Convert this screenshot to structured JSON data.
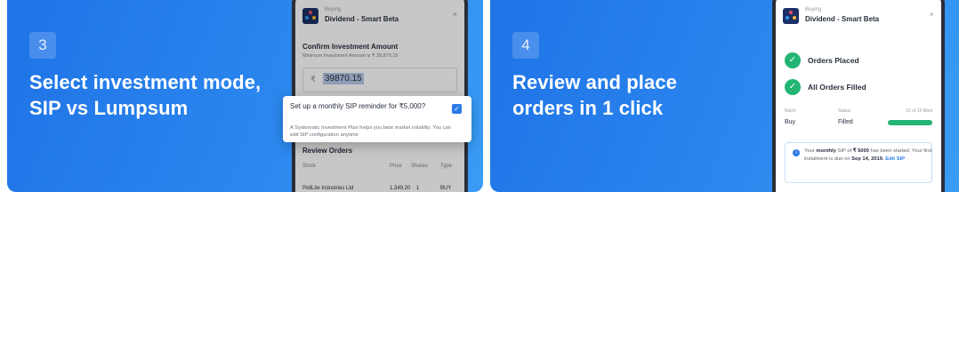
{
  "steps": [
    {
      "number": "3",
      "headline": [
        "Select investment mode,",
        "SIP vs Lumpsum"
      ],
      "mockup": {
        "buying_label": "Buying",
        "fund_name": "Dividend - Smart Beta",
        "close": "×",
        "confirm_title": "Confirm Investment Amount",
        "min_amount_text": "Minimum Investment Amount is ₹ 39,870.15",
        "currency": "₹",
        "amount": "39870.15",
        "popup": {
          "title": "Set up a monthly SIP reminder for ₹5,000?",
          "description": "A Systematic Investment Plan helps you beat market volatility. You can edit SIP configuration anytime",
          "checked": true
        },
        "review_title": "Review Orders",
        "columns": [
          "Stock",
          "Price",
          "Shares",
          "Type"
        ],
        "rows": [
          {
            "stock": "PidiLite Industries Ltd",
            "price": "1,349.20",
            "shares": "1",
            "type": "BUY"
          }
        ]
      }
    },
    {
      "number": "4",
      "headline": [
        "Review and place",
        "orders in 1 click"
      ],
      "mockup": {
        "buying_label": "Buying",
        "fund_name": "Dividend - Smart Beta",
        "close": "×",
        "statuses": [
          "Orders Placed",
          "All Orders Filled"
        ],
        "summary": {
          "headers": [
            "Batch",
            "Status",
            "15 of 15 filled"
          ],
          "batch": "Buy",
          "status": "Filled",
          "filled_fraction": 1.0
        },
        "note": {
          "pre": "Your ",
          "freq": "monthly",
          "mid": " SIP of ",
          "amount": "₹ 5000",
          "post": " has been started. Your first instalment is due on ",
          "date": "Sep 14, 2019.",
          "link": "Edit SIP"
        }
      }
    }
  ],
  "colors": {
    "card_gradient_start": "#1f73e6",
    "card_gradient_end": "#3a9cf5",
    "success": "#22b573",
    "primary": "#2b7be8"
  },
  "icons": [
    "app-logo-icon",
    "close-icon",
    "checkbox-checked-icon",
    "check-circle-icon",
    "info-icon"
  ]
}
